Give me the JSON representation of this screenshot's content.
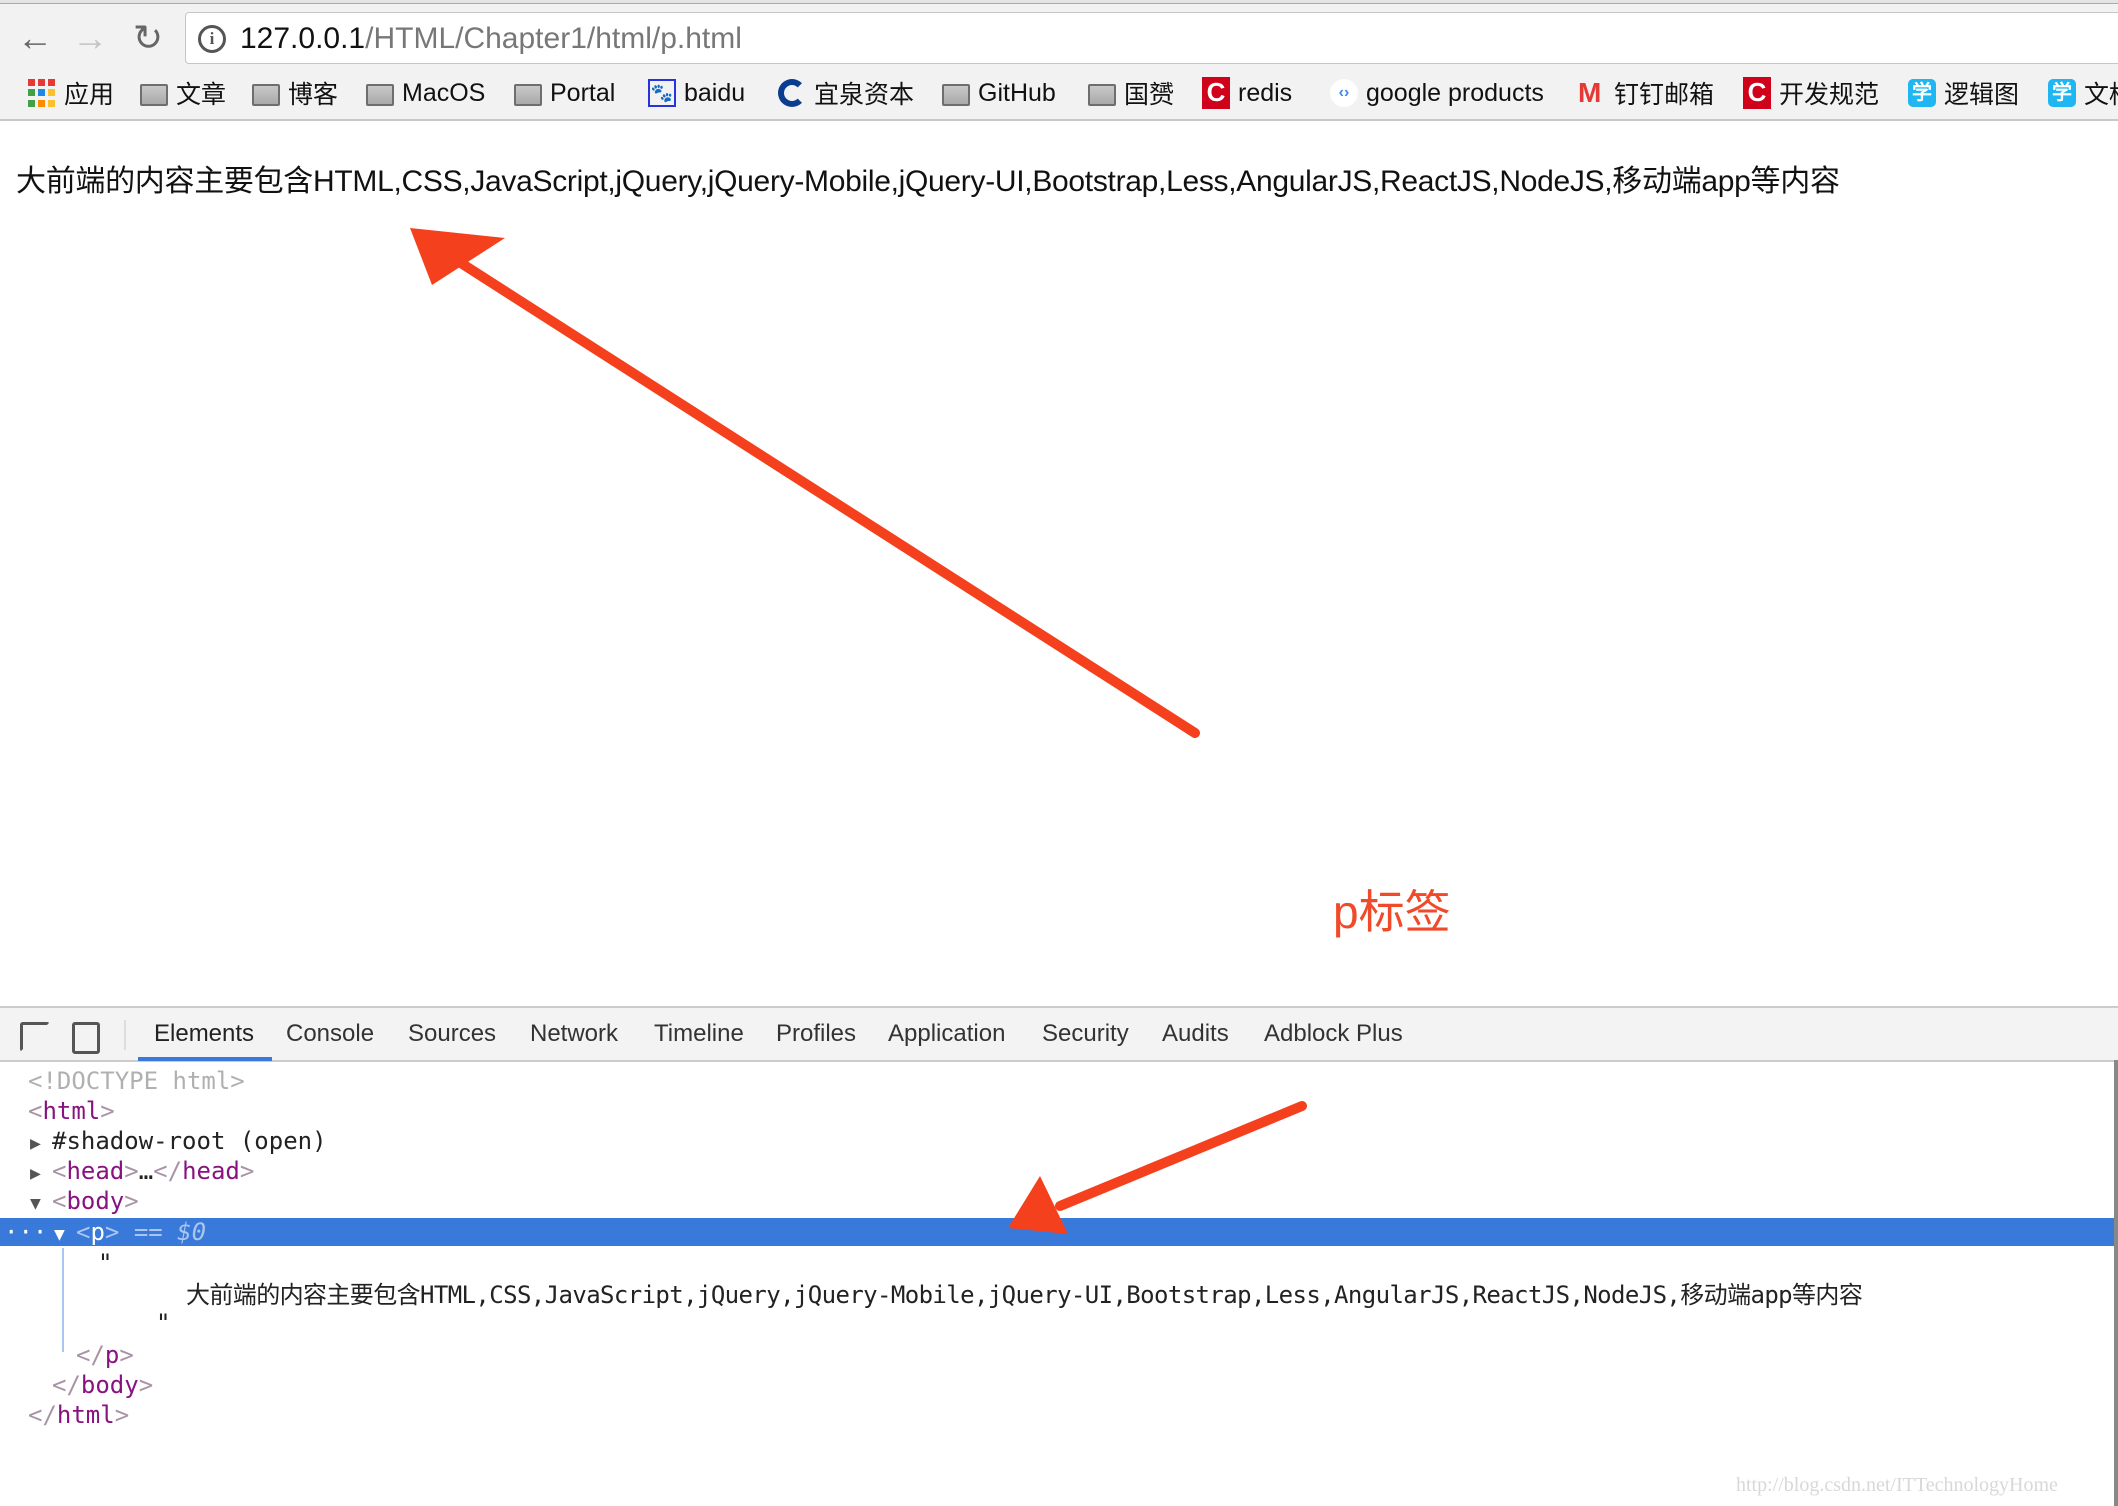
{
  "browser": {
    "url_host": "127.0.0.1",
    "url_path": "/HTML/Chapter1/html/p.html",
    "bookmarks": [
      {
        "label": "应用",
        "icon": "apps-grid-icon"
      },
      {
        "label": "文章",
        "icon": "folder-icon"
      },
      {
        "label": "博客",
        "icon": "folder-icon"
      },
      {
        "label": "MacOS",
        "icon": "folder-icon"
      },
      {
        "label": "Portal",
        "icon": "folder-icon"
      },
      {
        "label": "baidu",
        "icon": "baidu-paw-icon"
      },
      {
        "label": "宜泉资本",
        "icon": "yiquan-logo-icon"
      },
      {
        "label": "GitHub",
        "icon": "folder-icon"
      },
      {
        "label": "国赟",
        "icon": "folder-icon"
      },
      {
        "label": "redis",
        "icon": "csdn-c-icon"
      },
      {
        "label": "google products",
        "icon": "google-developers-icon"
      },
      {
        "label": "钉钉邮箱",
        "icon": "gmail-m-icon"
      },
      {
        "label": "开发规范",
        "icon": "csdn-c-icon"
      },
      {
        "label": "逻辑图",
        "icon": "xue-icon"
      },
      {
        "label": "文档",
        "icon": "xue-icon"
      }
    ]
  },
  "page": {
    "paragraph": "大前端的内容主要包含HTML,CSS,JavaScript,jQuery,jQuery-Mobile,jQuery-UI,Bootstrap,Less,AngularJS,ReactJS,NodeJS,移动端app等内容",
    "annotation": "p标签",
    "annotation_color": "#f04a2a",
    "arrow_color": "#f5401e"
  },
  "devtools": {
    "tabs": [
      "Elements",
      "Console",
      "Sources",
      "Network",
      "Timeline",
      "Profiles",
      "Application",
      "Security",
      "Audits",
      "Adblock Plus"
    ],
    "active_tab": "Elements",
    "dom": {
      "doctype": "<!DOCTYPE html>",
      "html_open": "html",
      "shadow_root": "#shadow-root (open)",
      "head": "head",
      "head_ellipsis": "…",
      "body": "body",
      "p": "p",
      "selected_suffix": "== $0",
      "row_dots": "···",
      "quote": "\"",
      "text_node": "大前端的内容主要包含HTML,CSS,JavaScript,jQuery,jQuery-Mobile,jQuery-UI,Bootstrap,Less,AngularJS,ReactJS,NodeJS,移动端app等内容"
    }
  },
  "watermark": "http://blog.csdn.net/ITTechnologyHome"
}
